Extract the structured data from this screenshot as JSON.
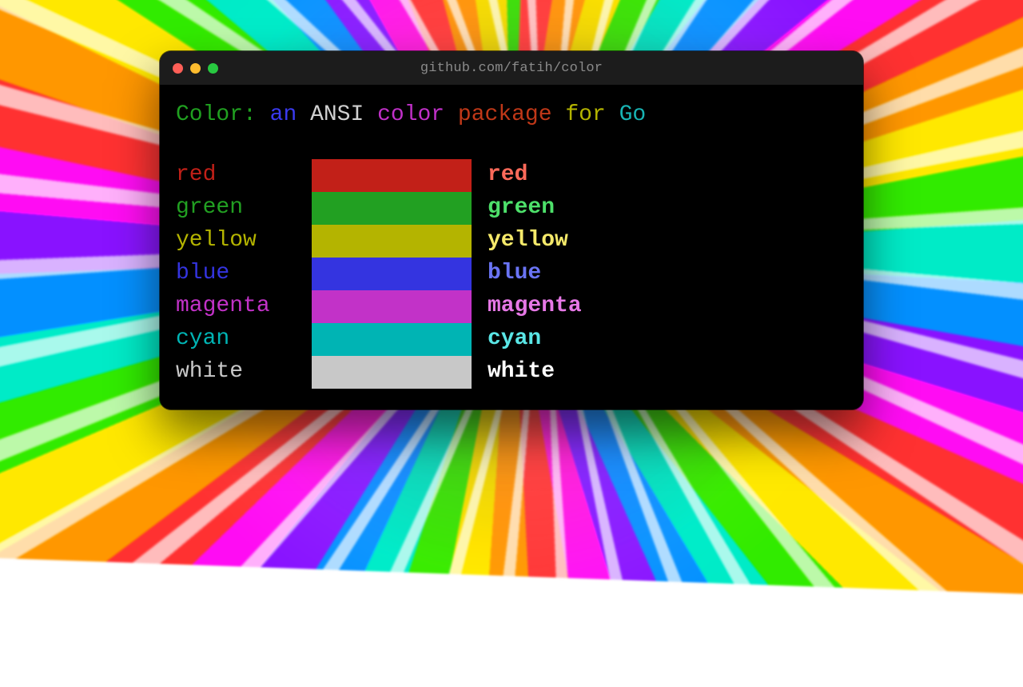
{
  "title": "github.com/fatih/color",
  "headline": [
    {
      "text": "Color:",
      "color": "#20a020"
    },
    {
      "text": " ",
      "color": "#000000"
    },
    {
      "text": "an",
      "color": "#3a3af0"
    },
    {
      "text": " ",
      "color": "#000000"
    },
    {
      "text": "ANSI",
      "color": "#d0d0d0"
    },
    {
      "text": " ",
      "color": "#000000"
    },
    {
      "text": "color",
      "color": "#c030c8"
    },
    {
      "text": " ",
      "color": "#000000"
    },
    {
      "text": "package",
      "color": "#c03818"
    },
    {
      "text": " ",
      "color": "#000000"
    },
    {
      "text": "for",
      "color": "#b4b400"
    },
    {
      "text": " ",
      "color": "#000000"
    },
    {
      "text": "Go",
      "color": "#18b4b4"
    }
  ],
  "colors": {
    "normal": {
      "red": "#c22018",
      "green": "#22a022",
      "yellow": "#b4b400",
      "blue": "#3434e0",
      "magenta": "#c232c8",
      "cyan": "#00b4b4",
      "white": "#c8c8c8"
    },
    "bright": {
      "red": "#ff6a5a",
      "green": "#4de06a",
      "yellow": "#f5e96a",
      "blue": "#6a74f5",
      "magenta": "#e678e6",
      "cyan": "#5ae6e6",
      "white": "#ffffff"
    }
  },
  "rows": [
    {
      "name": "red",
      "label": "red",
      "bright_label": "red"
    },
    {
      "name": "green",
      "label": "green",
      "bright_label": "green"
    },
    {
      "name": "yellow",
      "label": "yellow",
      "bright_label": "yellow"
    },
    {
      "name": "blue",
      "label": "blue",
      "bright_label": "blue"
    },
    {
      "name": "magenta",
      "label": "magenta",
      "bright_label": "magenta"
    },
    {
      "name": "cyan",
      "label": "cyan",
      "bright_label": "cyan"
    },
    {
      "name": "white",
      "label": "white",
      "bright_label": "white"
    }
  ]
}
